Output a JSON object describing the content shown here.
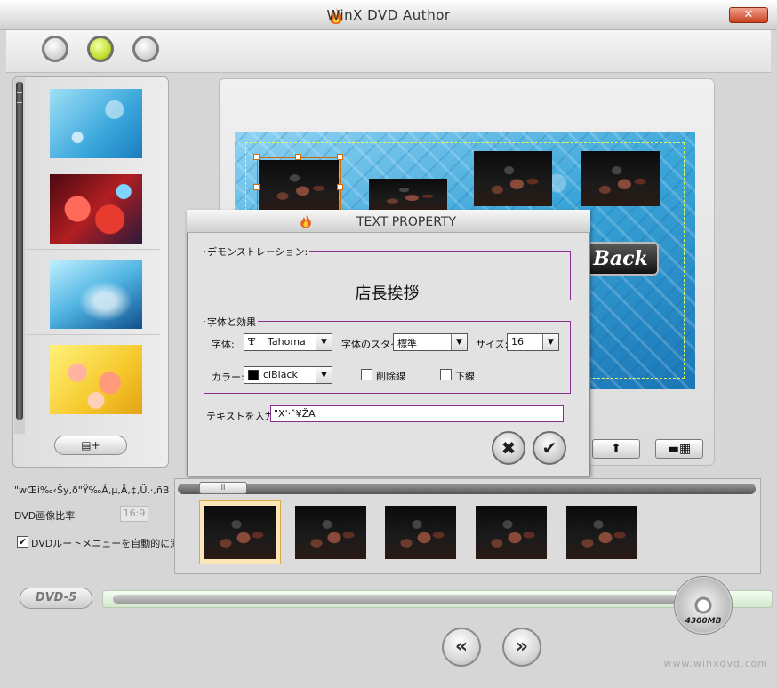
{
  "app": {
    "title": "WinX DVD Author",
    "close_label": "✕",
    "website": "www.winxdvd.com"
  },
  "toolbar": {
    "steps": [
      {
        "name": "step-1",
        "active": false
      },
      {
        "name": "step-2",
        "active": true
      },
      {
        "name": "step-3",
        "active": false
      }
    ]
  },
  "templates": {
    "add_button_label": "▤+"
  },
  "preview": {
    "back_label": "Back",
    "up_button_label": "⬆",
    "bar_button_label": "▬▦"
  },
  "dialog": {
    "title": "TEXT PROPERTY",
    "demo_group_label": "デモンストレーション:",
    "demo_text": "店長挨拶",
    "font_group_label": "字体と効果",
    "font_label": "字体:",
    "font_value": "Tahoma",
    "style_label": "字体のスタイ",
    "style_value": "標準",
    "size_label": "サイズ:",
    "size_value": "16",
    "color_label": "カラー:",
    "color_value": "clBlack",
    "color_swatch": "#000000",
    "strike_label": "削除線",
    "underline_label": "下線",
    "text_input_label": "テキストを入力:",
    "text_input_value": "\"X'·ˆ¥ŽA",
    "cancel_label": "✖",
    "ok_label": "✔"
  },
  "settings": {
    "garbled_label": "\"wŒi‰‹Šy,ð\"Ÿ‰Á,µ,Ä,¢,Ü,·,ñB",
    "aspect_label": "DVD画像比率",
    "aspect_value": "16:9",
    "auto_menu_label": "DVDルートメニューを自動的に添加する",
    "auto_menu_checked": true
  },
  "timeline": {
    "thumb_label": "II"
  },
  "bottom": {
    "dvd_badge": "DVD-5",
    "capacity": "4300MB",
    "prev_label": "«",
    "next_label": "»"
  },
  "colors": {
    "accent_green": "#c4e02e",
    "dialog_group_border": "#8a2d8f"
  }
}
